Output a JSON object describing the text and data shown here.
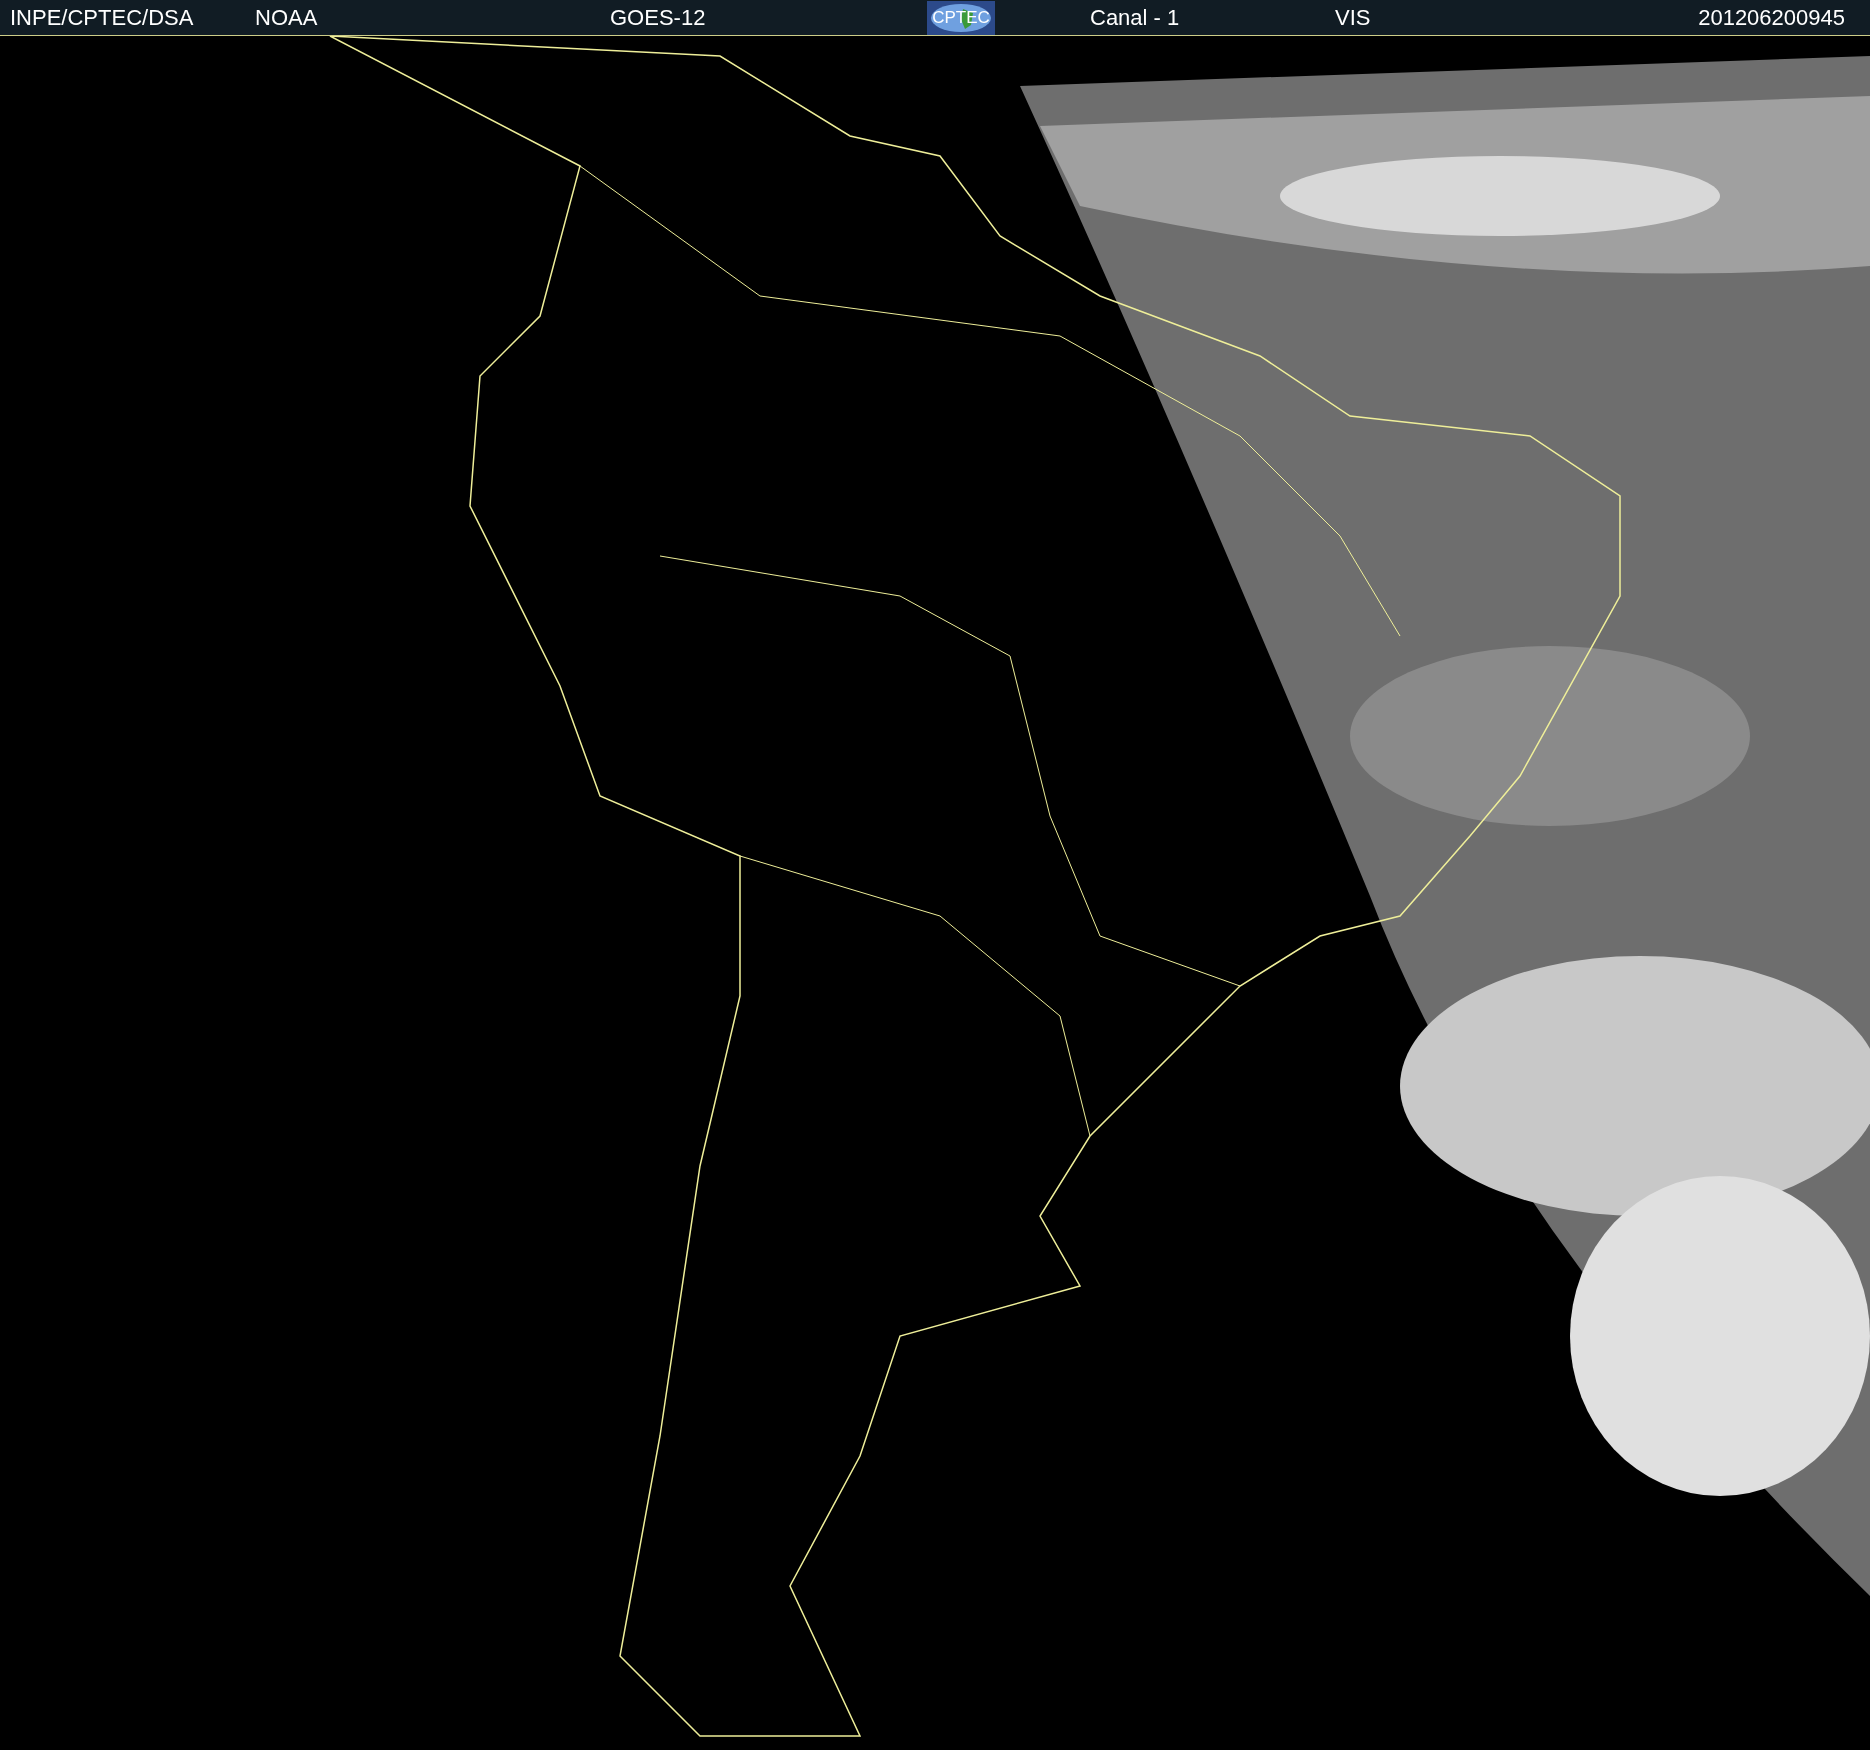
{
  "header": {
    "items": [
      {
        "kind": "text",
        "text": "INPE/CPTEC/DSA"
      },
      {
        "kind": "text",
        "text": "NOAA"
      },
      {
        "kind": "text",
        "text": "GOES-12"
      },
      {
        "kind": "logo",
        "text": "CPTEC"
      },
      {
        "kind": "text",
        "text": "Canal - 1"
      },
      {
        "kind": "text",
        "text": "VIS"
      },
      {
        "kind": "text",
        "text": "201206200945"
      }
    ]
  }
}
